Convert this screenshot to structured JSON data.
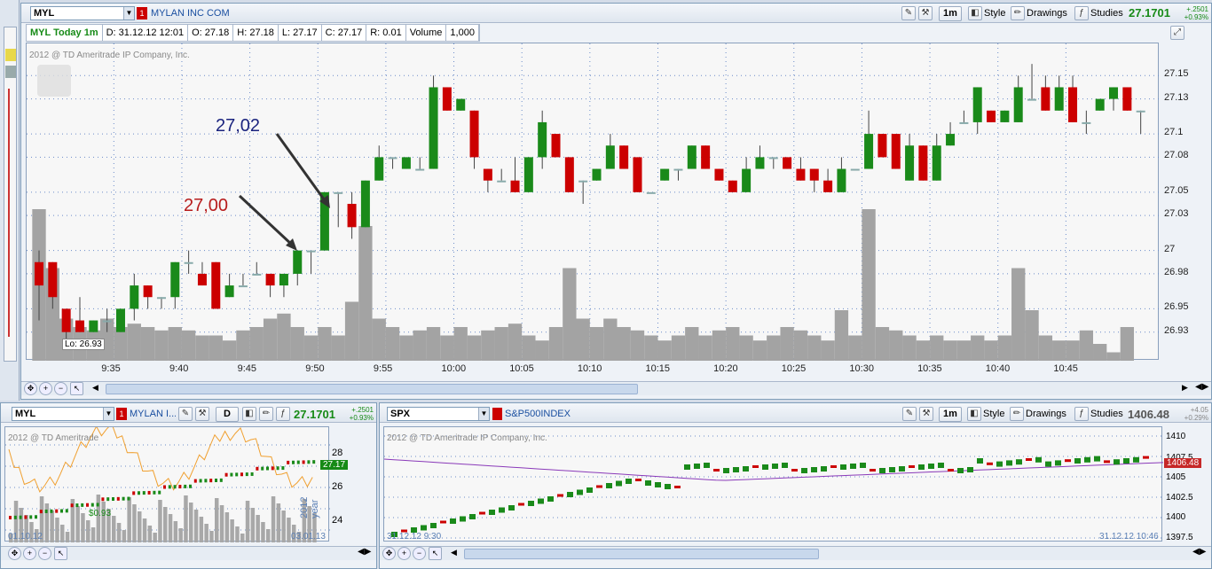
{
  "main": {
    "symbol": "MYL",
    "company": "MYLAN INC COM",
    "timeframe": "1m",
    "style_label": "Style",
    "drawings_label": "Drawings",
    "studies_label": "Studies",
    "last_price": "27.1701",
    "change": "+.2501",
    "change_pct": "+0.93%",
    "info_title": "MYL Today 1m",
    "info_date": "D: 31.12.12 12:01",
    "info_open": "O: 27.18",
    "info_high": "H: 27.18",
    "info_low": "L: 27.17",
    "info_close": "C: 27.17",
    "info_range": "R: 0.01",
    "info_volume_label": "Volume",
    "info_volume": "1,000",
    "copyright": "2012 @ TD Ameritrade IP Company, Inc.",
    "lo_label": "Lo: 26.93",
    "annotation_1": "27,02",
    "annotation_2": "27,00"
  },
  "left_bottom": {
    "symbol": "MYL",
    "company": "MYLAN I...",
    "timeframe": "D",
    "last_price": "27.1701",
    "change": "+.2501",
    "change_pct": "+0.93%",
    "copyright": "2012 @ TD Ameritrade",
    "y_ticks": [
      "28",
      "26",
      "24"
    ],
    "price_tag": "27.17",
    "marker": "$0.93",
    "date_start": "01.10.12",
    "date_end": "03.01.13",
    "year_label": "2012 year"
  },
  "right_bottom": {
    "symbol": "SPX",
    "company": "S&P500INDEX",
    "timeframe": "1m",
    "style_label": "Style",
    "drawings_label": "Drawings",
    "studies_label": "Studies",
    "last_price": "1406.48",
    "change": "+4.05",
    "change_pct": "+0.29%",
    "copyright": "2012 @ TD Ameritrade IP Company, Inc.",
    "y_ticks": [
      "1410",
      "1407.5",
      "1405",
      "1402.5",
      "1400",
      "1397.5"
    ],
    "price_tag": "1406.48",
    "date_start": "31.12.12 9:30",
    "date_end": "31.12.12 10:46"
  },
  "chart_data": [
    {
      "type": "candlestick",
      "title": "MYL Today 1m",
      "x_ticks": [
        "9:35",
        "9:40",
        "9:45",
        "9:50",
        "9:55",
        "10:00",
        "10:05",
        "10:10",
        "10:15",
        "10:20",
        "10:25",
        "10:30",
        "10:35",
        "10:40",
        "10:45"
      ],
      "y_ticks": [
        27.15,
        27.13,
        27.1,
        27.08,
        27.05,
        27.03,
        27.0,
        26.98,
        26.95,
        26.93
      ],
      "ylim": [
        26.91,
        27.17
      ],
      "grid": true,
      "candles": [
        [
          26.99,
          26.97,
          27.0,
          26.94
        ],
        [
          26.99,
          26.96,
          26.99,
          26.95
        ],
        [
          26.95,
          26.93,
          26.95,
          26.92
        ],
        [
          26.94,
          26.93,
          26.96,
          26.93
        ],
        [
          26.93,
          26.94,
          26.94,
          26.93
        ],
        [
          26.94,
          26.94,
          26.95,
          26.93
        ],
        [
          26.93,
          26.95,
          26.95,
          26.93
        ],
        [
          26.95,
          26.97,
          26.98,
          26.94
        ],
        [
          26.97,
          26.96,
          26.97,
          26.95
        ],
        [
          26.96,
          26.96,
          26.96,
          26.95
        ],
        [
          26.96,
          26.99,
          26.99,
          26.95
        ],
        [
          26.99,
          26.99,
          27.0,
          26.98
        ],
        [
          26.98,
          26.97,
          26.99,
          26.97
        ],
        [
          26.99,
          26.95,
          26.99,
          26.95
        ],
        [
          26.96,
          26.97,
          26.98,
          26.96
        ],
        [
          26.97,
          26.97,
          26.98,
          26.97
        ],
        [
          26.98,
          26.98,
          26.99,
          26.98
        ],
        [
          26.98,
          26.97,
          26.98,
          26.96
        ],
        [
          26.97,
          26.98,
          26.98,
          26.96
        ],
        [
          26.98,
          27.0,
          27.0,
          26.97
        ],
        [
          27.0,
          27.0,
          27.0,
          26.98
        ],
        [
          27.0,
          27.05,
          27.05,
          27.0
        ],
        [
          27.05,
          27.05,
          27.05,
          27.02
        ],
        [
          27.04,
          27.02,
          27.05,
          27.01
        ],
        [
          27.02,
          27.06,
          27.06,
          27.02
        ],
        [
          27.06,
          27.08,
          27.09,
          27.06
        ],
        [
          27.08,
          27.08,
          27.08,
          27.07
        ],
        [
          27.07,
          27.08,
          27.08,
          27.07
        ],
        [
          27.07,
          27.07,
          27.08,
          27.07
        ],
        [
          27.07,
          27.14,
          27.15,
          27.07
        ],
        [
          27.14,
          27.12,
          27.14,
          27.12
        ],
        [
          27.12,
          27.13,
          27.13,
          27.12
        ],
        [
          27.12,
          27.08,
          27.12,
          27.07
        ],
        [
          27.07,
          27.06,
          27.07,
          27.05
        ],
        [
          27.06,
          27.06,
          27.07,
          27.06
        ],
        [
          27.06,
          27.05,
          27.08,
          27.05
        ],
        [
          27.05,
          27.08,
          27.08,
          27.05
        ],
        [
          27.08,
          27.11,
          27.12,
          27.07
        ],
        [
          27.1,
          27.08,
          27.1,
          27.08
        ],
        [
          27.08,
          27.05,
          27.08,
          27.05
        ],
        [
          27.06,
          27.06,
          27.06,
          27.04
        ],
        [
          27.06,
          27.07,
          27.07,
          27.06
        ],
        [
          27.07,
          27.09,
          27.1,
          27.07
        ],
        [
          27.09,
          27.07,
          27.09,
          27.07
        ],
        [
          27.08,
          27.05,
          27.08,
          27.05
        ],
        [
          27.05,
          27.05,
          27.05,
          27.05
        ],
        [
          27.06,
          27.07,
          27.07,
          27.06
        ],
        [
          27.07,
          27.07,
          27.07,
          27.06
        ],
        [
          27.07,
          27.09,
          27.09,
          27.07
        ],
        [
          27.09,
          27.07,
          27.09,
          27.07
        ],
        [
          27.07,
          27.06,
          27.07,
          27.06
        ],
        [
          27.06,
          27.05,
          27.06,
          27.05
        ],
        [
          27.05,
          27.07,
          27.08,
          27.05
        ],
        [
          27.07,
          27.08,
          27.09,
          27.07
        ],
        [
          27.08,
          27.08,
          27.08,
          27.07
        ],
        [
          27.08,
          27.07,
          27.08,
          27.07
        ],
        [
          27.07,
          27.06,
          27.08,
          27.06
        ],
        [
          27.07,
          27.06,
          27.07,
          27.05
        ],
        [
          27.06,
          27.05,
          27.07,
          27.05
        ],
        [
          27.05,
          27.07,
          27.08,
          27.05
        ],
        [
          27.07,
          27.07,
          27.07,
          27.07
        ],
        [
          27.07,
          27.1,
          27.12,
          27.07
        ],
        [
          27.1,
          27.08,
          27.1,
          27.08
        ],
        [
          27.1,
          27.07,
          27.1,
          27.07
        ],
        [
          27.06,
          27.09,
          27.1,
          27.06
        ],
        [
          27.09,
          27.06,
          27.09,
          27.06
        ],
        [
          27.06,
          27.09,
          27.1,
          27.06
        ],
        [
          27.09,
          27.1,
          27.11,
          27.09
        ],
        [
          27.11,
          27.11,
          27.12,
          27.11
        ],
        [
          27.11,
          27.14,
          27.14,
          27.1
        ],
        [
          27.12,
          27.11,
          27.12,
          27.11
        ],
        [
          27.11,
          27.12,
          27.12,
          27.11
        ],
        [
          27.11,
          27.14,
          27.15,
          27.11
        ],
        [
          27.13,
          27.13,
          27.16,
          27.13
        ],
        [
          27.14,
          27.12,
          27.15,
          27.12
        ],
        [
          27.12,
          27.14,
          27.15,
          27.12
        ],
        [
          27.14,
          27.11,
          27.15,
          27.11
        ],
        [
          27.11,
          27.11,
          27.12,
          27.1
        ],
        [
          27.12,
          27.13,
          27.13,
          27.12
        ],
        [
          27.13,
          27.14,
          27.14,
          27.12
        ],
        [
          27.14,
          27.12,
          27.14,
          27.12
        ],
        [
          27.12,
          27.12,
          27.12,
          27.1
        ]
      ],
      "volume_relative": [
        0.9,
        0.55,
        0.25,
        0.2,
        0.18,
        0.25,
        0.2,
        0.22,
        0.2,
        0.18,
        0.2,
        0.18,
        0.15,
        0.15,
        0.12,
        0.18,
        0.2,
        0.25,
        0.28,
        0.2,
        0.15,
        0.2,
        0.15,
        0.35,
        0.8,
        0.25,
        0.2,
        0.15,
        0.18,
        0.2,
        0.15,
        0.2,
        0.15,
        0.18,
        0.2,
        0.22,
        0.15,
        0.12,
        0.2,
        0.55,
        0.25,
        0.2,
        0.25,
        0.2,
        0.18,
        0.15,
        0.12,
        0.15,
        0.2,
        0.15,
        0.18,
        0.2,
        0.15,
        0.12,
        0.15,
        0.2,
        0.18,
        0.15,
        0.12,
        0.3,
        0.15,
        0.9,
        0.2,
        0.18,
        0.15,
        0.12,
        0.15,
        0.12,
        0.12,
        0.15,
        0.12,
        0.15,
        0.55,
        0.3,
        0.15,
        0.12,
        0.12,
        0.18,
        0.1,
        0.05,
        0.2
      ]
    }
  ]
}
